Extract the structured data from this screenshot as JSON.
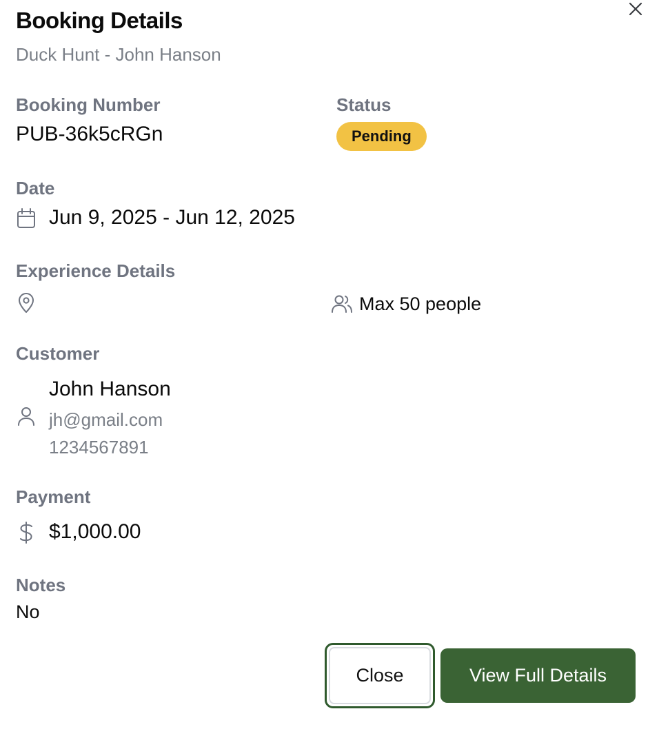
{
  "header": {
    "title": "Booking Details",
    "subtitle": "Duck Hunt - John Hanson",
    "close_icon": "x-icon"
  },
  "booking": {
    "number_label": "Booking Number",
    "number": "PUB-36k5cRGn",
    "status_label": "Status",
    "status": "Pending",
    "status_color": "#f2c244"
  },
  "date": {
    "label": "Date",
    "icon": "calendar-icon",
    "value": "Jun 9, 2025 - Jun 12, 2025"
  },
  "experience": {
    "label": "Experience Details",
    "location_icon": "map-pin-icon",
    "capacity_icon": "users-icon",
    "capacity": "Max 50 people"
  },
  "customer": {
    "label": "Customer",
    "icon": "user-icon",
    "name": "John Hanson",
    "email": "jh@gmail.com",
    "phone": "1234567891"
  },
  "payment": {
    "label": "Payment",
    "icon": "dollar-icon",
    "amount": "$1,000.00"
  },
  "notes": {
    "label": "Notes",
    "value": "No"
  },
  "footer": {
    "close_label": "Close",
    "primary_label": "View Full Details",
    "primary_color": "#3a6334"
  }
}
